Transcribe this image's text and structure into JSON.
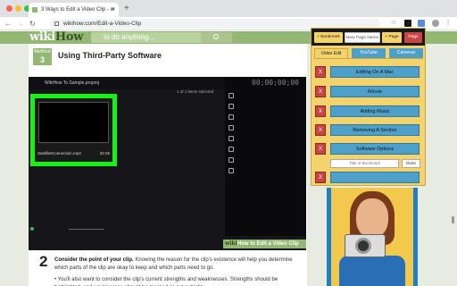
{
  "browser": {
    "tab_title": "3 Ways to Edit a Video Clip - w",
    "tab_close": "×",
    "new_tab": "+",
    "back": "←",
    "forward": "→",
    "reload": "↻",
    "url": "wikihow.com/Edit-a-Video-Clip"
  },
  "site": {
    "logo_wiki": "wiki",
    "logo_how": "How",
    "search_placeholder": "to do anything..."
  },
  "article": {
    "method_label": "Method",
    "method_number": "3",
    "method_title": "Using Third-Party Software",
    "screenshot": {
      "project_title": "WikiHow To Sample.proproj",
      "selection_info": "1 of 1 items selected",
      "timecode": "00;00;00;00",
      "clip_name": "SatelliteConnection.mp4",
      "clip_duration": "32:25"
    },
    "watermark_wiki": "wiki",
    "watermark_rest": "How to Edit a Video Clip",
    "step_number": "2",
    "step_bold": "Consider the point of your clip.",
    "step_text": " Knowing the reason for the clip's existence will help you determine which parts of the clip are okay to keep and which parts need to go.",
    "bullet_text": "You'll also want to consider the clip's current strengths and weaknesses. Strengths should be highlighted, and weaknesses should be masked or cut outright."
  },
  "extension": {
    "bookmark_button": "+ Bookmark",
    "page_name_placeholder": "New Page Name",
    "page_button": "+ Page",
    "pages_button": "Pags",
    "tabs": [
      "Video Edit",
      "YouTube",
      "Cameras"
    ],
    "delete_label": "X",
    "items": [
      "Editing On A Mac",
      "iMovie",
      "Adding Music",
      "Removing A Section",
      "Software Options"
    ],
    "title_placeholder": "Title of Bookmark",
    "done_button": "Done"
  },
  "colors": {
    "wikihow_green": "#93b874",
    "ext_yellow": "#f5d36c",
    "ext_blue": "#4fa0c8",
    "ext_red": "#c94545",
    "highlight_green": "#18f018"
  }
}
